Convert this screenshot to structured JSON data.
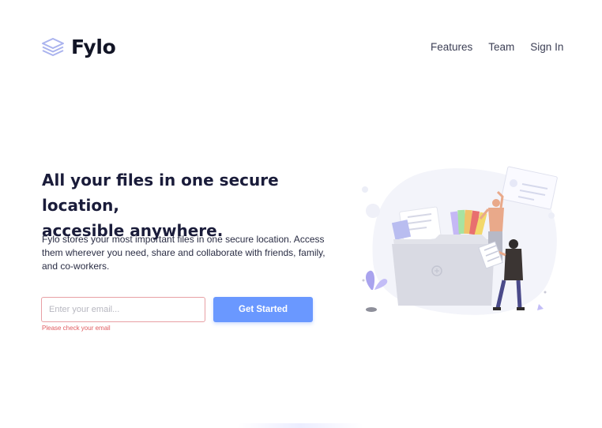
{
  "brand": {
    "name": "Fylo",
    "accent_color": "#6a98ff",
    "logo_icon": "layers-icon"
  },
  "nav": {
    "items": [
      {
        "label": "Features"
      },
      {
        "label": "Team"
      },
      {
        "label": "Sign In"
      }
    ]
  },
  "hero": {
    "title_line1": "All your files in one secure location,",
    "title_line2": "accesible anywhere.",
    "description": "Fylo stores your most important files in one secure location. Access them wherever you need, share and collaborate with friends, family, and co-workers.",
    "illustration": "file-sharing-illustration"
  },
  "signup": {
    "email_placeholder": "Enter your email...",
    "email_value": "",
    "button_label": "Get Started",
    "error_message": "Please check your email",
    "error_color": "#e05d62"
  }
}
